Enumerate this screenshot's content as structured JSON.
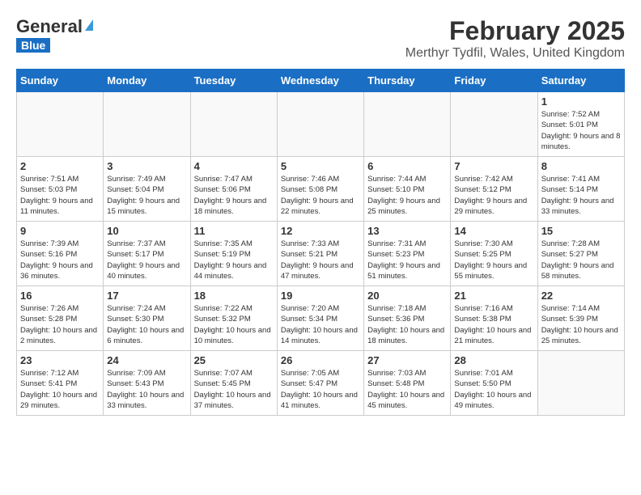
{
  "header": {
    "logo_general": "General",
    "logo_blue": "Blue",
    "month_year": "February 2025",
    "location": "Merthyr Tydfil, Wales, United Kingdom"
  },
  "days_of_week": [
    "Sunday",
    "Monday",
    "Tuesday",
    "Wednesday",
    "Thursday",
    "Friday",
    "Saturday"
  ],
  "weeks": [
    [
      {
        "day": "",
        "info": ""
      },
      {
        "day": "",
        "info": ""
      },
      {
        "day": "",
        "info": ""
      },
      {
        "day": "",
        "info": ""
      },
      {
        "day": "",
        "info": ""
      },
      {
        "day": "",
        "info": ""
      },
      {
        "day": "1",
        "info": "Sunrise: 7:52 AM\nSunset: 5:01 PM\nDaylight: 9 hours and 8 minutes."
      }
    ],
    [
      {
        "day": "2",
        "info": "Sunrise: 7:51 AM\nSunset: 5:03 PM\nDaylight: 9 hours and 11 minutes."
      },
      {
        "day": "3",
        "info": "Sunrise: 7:49 AM\nSunset: 5:04 PM\nDaylight: 9 hours and 15 minutes."
      },
      {
        "day": "4",
        "info": "Sunrise: 7:47 AM\nSunset: 5:06 PM\nDaylight: 9 hours and 18 minutes."
      },
      {
        "day": "5",
        "info": "Sunrise: 7:46 AM\nSunset: 5:08 PM\nDaylight: 9 hours and 22 minutes."
      },
      {
        "day": "6",
        "info": "Sunrise: 7:44 AM\nSunset: 5:10 PM\nDaylight: 9 hours and 25 minutes."
      },
      {
        "day": "7",
        "info": "Sunrise: 7:42 AM\nSunset: 5:12 PM\nDaylight: 9 hours and 29 minutes."
      },
      {
        "day": "8",
        "info": "Sunrise: 7:41 AM\nSunset: 5:14 PM\nDaylight: 9 hours and 33 minutes."
      }
    ],
    [
      {
        "day": "9",
        "info": "Sunrise: 7:39 AM\nSunset: 5:16 PM\nDaylight: 9 hours and 36 minutes."
      },
      {
        "day": "10",
        "info": "Sunrise: 7:37 AM\nSunset: 5:17 PM\nDaylight: 9 hours and 40 minutes."
      },
      {
        "day": "11",
        "info": "Sunrise: 7:35 AM\nSunset: 5:19 PM\nDaylight: 9 hours and 44 minutes."
      },
      {
        "day": "12",
        "info": "Sunrise: 7:33 AM\nSunset: 5:21 PM\nDaylight: 9 hours and 47 minutes."
      },
      {
        "day": "13",
        "info": "Sunrise: 7:31 AM\nSunset: 5:23 PM\nDaylight: 9 hours and 51 minutes."
      },
      {
        "day": "14",
        "info": "Sunrise: 7:30 AM\nSunset: 5:25 PM\nDaylight: 9 hours and 55 minutes."
      },
      {
        "day": "15",
        "info": "Sunrise: 7:28 AM\nSunset: 5:27 PM\nDaylight: 9 hours and 58 minutes."
      }
    ],
    [
      {
        "day": "16",
        "info": "Sunrise: 7:26 AM\nSunset: 5:28 PM\nDaylight: 10 hours and 2 minutes."
      },
      {
        "day": "17",
        "info": "Sunrise: 7:24 AM\nSunset: 5:30 PM\nDaylight: 10 hours and 6 minutes."
      },
      {
        "day": "18",
        "info": "Sunrise: 7:22 AM\nSunset: 5:32 PM\nDaylight: 10 hours and 10 minutes."
      },
      {
        "day": "19",
        "info": "Sunrise: 7:20 AM\nSunset: 5:34 PM\nDaylight: 10 hours and 14 minutes."
      },
      {
        "day": "20",
        "info": "Sunrise: 7:18 AM\nSunset: 5:36 PM\nDaylight: 10 hours and 18 minutes."
      },
      {
        "day": "21",
        "info": "Sunrise: 7:16 AM\nSunset: 5:38 PM\nDaylight: 10 hours and 21 minutes."
      },
      {
        "day": "22",
        "info": "Sunrise: 7:14 AM\nSunset: 5:39 PM\nDaylight: 10 hours and 25 minutes."
      }
    ],
    [
      {
        "day": "23",
        "info": "Sunrise: 7:12 AM\nSunset: 5:41 PM\nDaylight: 10 hours and 29 minutes."
      },
      {
        "day": "24",
        "info": "Sunrise: 7:09 AM\nSunset: 5:43 PM\nDaylight: 10 hours and 33 minutes."
      },
      {
        "day": "25",
        "info": "Sunrise: 7:07 AM\nSunset: 5:45 PM\nDaylight: 10 hours and 37 minutes."
      },
      {
        "day": "26",
        "info": "Sunrise: 7:05 AM\nSunset: 5:47 PM\nDaylight: 10 hours and 41 minutes."
      },
      {
        "day": "27",
        "info": "Sunrise: 7:03 AM\nSunset: 5:48 PM\nDaylight: 10 hours and 45 minutes."
      },
      {
        "day": "28",
        "info": "Sunrise: 7:01 AM\nSunset: 5:50 PM\nDaylight: 10 hours and 49 minutes."
      },
      {
        "day": "",
        "info": ""
      }
    ]
  ]
}
